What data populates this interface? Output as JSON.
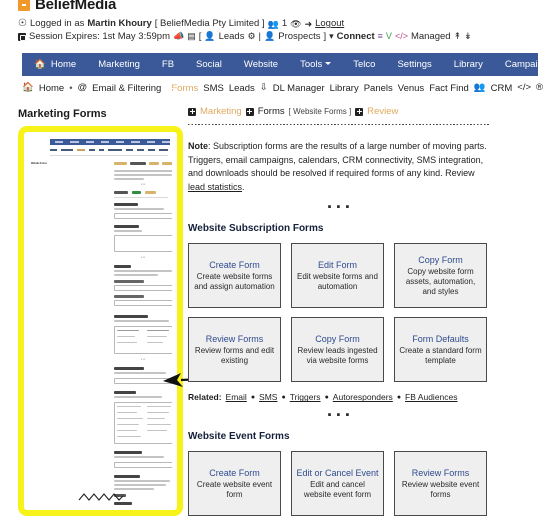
{
  "brand": {
    "name": "BeliefMedia",
    "mark_color": "#f0992a"
  },
  "status": {
    "line1": {
      "user_icon": "user-circle-icon",
      "prefix": "Logged in as ",
      "user": "Martin Khoury",
      "company": " [ BeliefMedia Pty Limited ] ",
      "team_icon": "users-icon",
      "team_count": "1",
      "eye_icon": "eye-icon",
      "logout_icon": "sign-out-icon",
      "logout": "Logout"
    },
    "line2": {
      "clock_icon": "session-icon",
      "text": "Session Expires: 1st May 3:59pm",
      "icon_mic": "megaphone-icon",
      "icon_card": "card-icon",
      "bracket_open": "[",
      "leads_icon": "lead-icon",
      "leads": "Leads",
      "gear_icon": "gear-icon",
      "pipe": "|",
      "prospect_icon": "prospect-icon",
      "prospects": "Prospects",
      "bracket_close": "]",
      "connect_icon": "connect-icon",
      "connect": "Connect",
      "list_icon": "list-icon",
      "v_icon": "v-icon",
      "code_icon": "code-icon",
      "managed": "Managed",
      "upload_icon": "upload-icon",
      "download_icon": "download-icon"
    }
  },
  "nav_main": {
    "bg": "#3b5998",
    "home_icon": "home-icon",
    "items": [
      {
        "label": "Home",
        "icon": "home-icon"
      },
      {
        "label": "Marketing"
      },
      {
        "label": "FB"
      },
      {
        "label": "Social"
      },
      {
        "label": "Website"
      },
      {
        "label": "Tools",
        "caret": true
      },
      {
        "label": "Telco"
      },
      {
        "label": "Settings"
      },
      {
        "label": "Library"
      },
      {
        "label": "Campaigns"
      }
    ]
  },
  "nav_sub": {
    "active_color": "#e0a95f",
    "items": [
      {
        "icon": "home-icon",
        "label": "Home"
      },
      {
        "label": "•",
        "sep": true
      },
      {
        "icon": "at-icon",
        "label": "Email & Filtering"
      },
      {
        "icon": "plus-box-icon",
        "label": "Forms",
        "active": true
      },
      {
        "label": "SMS"
      },
      {
        "label": "Leads"
      },
      {
        "icon": "chevrons-down-icon",
        "label": "DL Manager"
      },
      {
        "label": "Library"
      },
      {
        "label": "Panels"
      },
      {
        "label": "Venus"
      },
      {
        "label": "Fact Find"
      },
      {
        "icon": "users-icon",
        "label": "CRM"
      },
      {
        "icon": "code-icon",
        "label": ""
      },
      {
        "icon": "wordpress-icon",
        "label": ""
      }
    ]
  },
  "left_panel": {
    "title": "Marketing Forms",
    "highlight_color": "#f7f31a",
    "thumbnail": {
      "alt": "marketing-forms-screenshot-thumbnail",
      "section_label": "Website Forms",
      "field_labels": [
        "Website Form Name",
        "Website Description",
        "Form Design",
        "Form Submit Button Text",
        "Email Template",
        "Form Fields",
        "Redirect Options"
      ],
      "squiggle": "zigzag-divider"
    },
    "annotation": {
      "arrow": "left-pointing-arrow"
    }
  },
  "breadcrumb": {
    "marketing": "Marketing",
    "forms": "Forms",
    "context": "[ Website Forms ]",
    "review": "Review"
  },
  "note": {
    "label": "Note",
    "body": ": Subscription forms are the results of a large number of moving parts. Triggers, email campaigns, calendars, CRM connectivity, SMS integration, and downloads should be resolved if required forms of any kind. Review ",
    "link": "lead statistics",
    "tail": "."
  },
  "divider_glyph": "▪ ▪ ▪",
  "sections": [
    {
      "title": "Website Subscription Forms",
      "rows": [
        [
          {
            "title": "Create Form",
            "desc": "Create website forms and assign automation"
          },
          {
            "title": "Edit Form",
            "desc": "Edit website forms and automation"
          },
          {
            "title": "Copy Form",
            "desc": "Copy website form assets, automation, and styles"
          }
        ],
        [
          {
            "title": "Review Forms",
            "desc": "Review forms and edit existing"
          },
          {
            "title": "Copy Form",
            "desc": "Review leads ingested via website forms"
          },
          {
            "title": "Form Defaults",
            "desc": "Create a standard form template"
          }
        ]
      ],
      "related": {
        "label": "Related:",
        "links": [
          "Email",
          "SMS",
          "Triggers",
          "Autoresponders",
          "FB Audiences"
        ]
      }
    },
    {
      "title": "Website Event Forms",
      "rows": [
        [
          {
            "title": "Create Form",
            "desc": "Create website event form"
          },
          {
            "title": "Edit or Cancel Event",
            "desc": "Edit and cancel website event form"
          },
          {
            "title": "Review Forms",
            "desc": "Review website event forms"
          }
        ]
      ]
    }
  ],
  "colors": {
    "card_title": "#2f4b8f",
    "card_bg": "#efefef",
    "nav_bg": "#3b5998",
    "accent_orange": "#e0a95f",
    "highlight_yellow": "#f7f31a"
  }
}
